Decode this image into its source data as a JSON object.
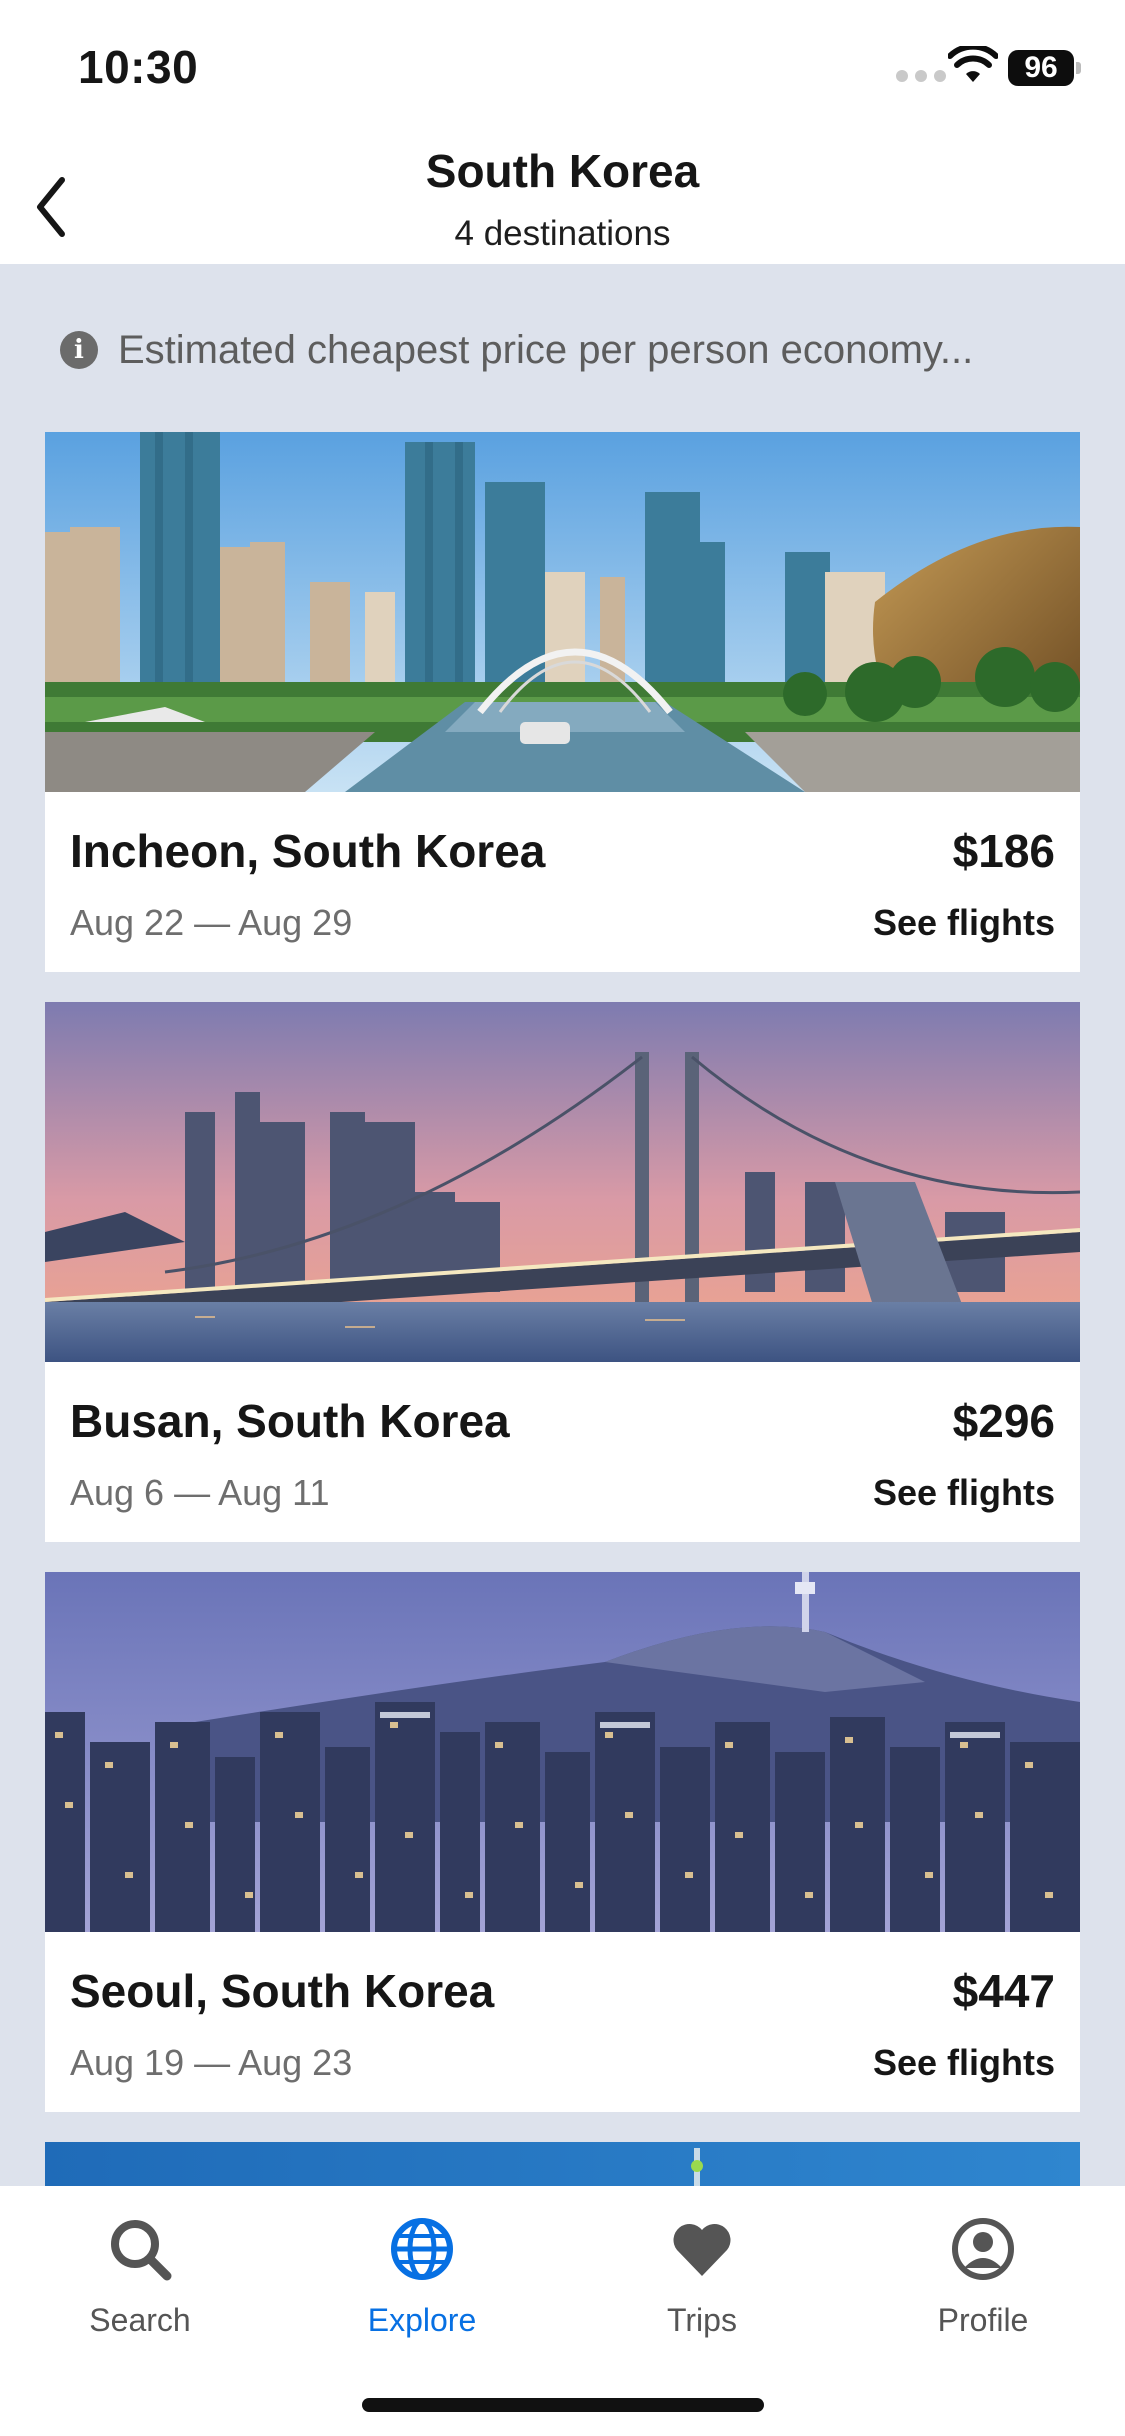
{
  "status_bar": {
    "time": "10:30",
    "battery": "96"
  },
  "header": {
    "title": "South Korea",
    "subtitle": "4 destinations"
  },
  "info": {
    "text": "Estimated cheapest price per person economy..."
  },
  "destinations": [
    {
      "city": "Incheon, South Korea",
      "dates": "Aug 22 — Aug 29",
      "price": "$186",
      "action": "See flights"
    },
    {
      "city": "Busan, South Korea",
      "dates": "Aug 6 — Aug 11",
      "price": "$296",
      "action": "See flights"
    },
    {
      "city": "Seoul, South Korea",
      "dates": "Aug 19 — Aug 23",
      "price": "$447",
      "action": "See flights"
    }
  ],
  "tabs": [
    {
      "label": "Search",
      "icon": "search-icon"
    },
    {
      "label": "Explore",
      "icon": "globe-icon",
      "active": true
    },
    {
      "label": "Trips",
      "icon": "heart-icon"
    },
    {
      "label": "Profile",
      "icon": "profile-icon"
    }
  ],
  "colors": {
    "accent": "#0770e3",
    "background": "#dde2ec"
  }
}
